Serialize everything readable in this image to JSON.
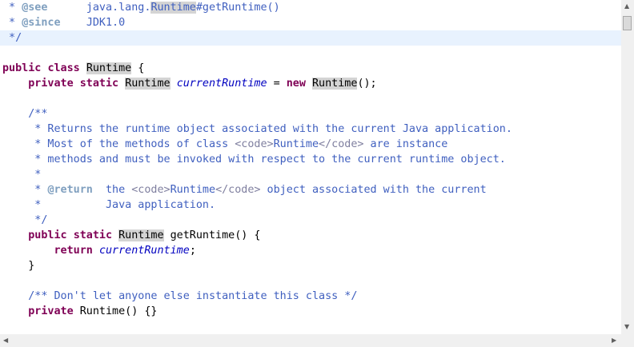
{
  "editor": {
    "lines": {
      "see_prefix": " * ",
      "see_tag": "@see",
      "see_ref_a": "java.lang.",
      "see_ref_b": "Runtime",
      "see_ref_c": "#getRuntime()",
      "since_prefix": " * ",
      "since_tag": "@since",
      "since_val": "JDK1.0",
      "close_comment": " */",
      "class_kw1": "public",
      "class_kw2": "class",
      "class_name": "Runtime",
      "class_brace": " {",
      "field_kw1": "private",
      "field_kw2": "static",
      "field_type": "Runtime",
      "field_name": "currentRuntime",
      "field_eq": " = ",
      "field_new": "new",
      "field_ctor": "Runtime",
      "field_end": "();",
      "doc_open": "/**",
      "doc1": " * Returns the runtime object associated with the current Java application.",
      "doc2_a": " * Most of the methods of class ",
      "doc2_tag1": "<code>",
      "doc2_b": "Runtime",
      "doc2_tag2": "</code>",
      "doc2_c": " are instance",
      "doc3": " * methods and must be invoked with respect to the current runtime object.",
      "doc4": " *",
      "doc5_a": " * ",
      "doc5_tag": "@return",
      "doc5_b": "  the ",
      "doc5_tag1": "<code>",
      "doc5_c": "Runtime",
      "doc5_tag2": "</code>",
      "doc5_d": " object associated with the current",
      "doc6": " *          Java application.",
      "doc_close": " */",
      "m_kw1": "public",
      "m_kw2": "static",
      "m_type": "Runtime",
      "m_sig": " getRuntime() {",
      "ret_kw": "return",
      "ret_val": "currentRuntime",
      "ret_end": ";",
      "m_close": "}",
      "c_comment": "/** Don't let anyone else instantiate this class */",
      "c_kw": "private",
      "c_sig": " Runtime() {}"
    }
  }
}
